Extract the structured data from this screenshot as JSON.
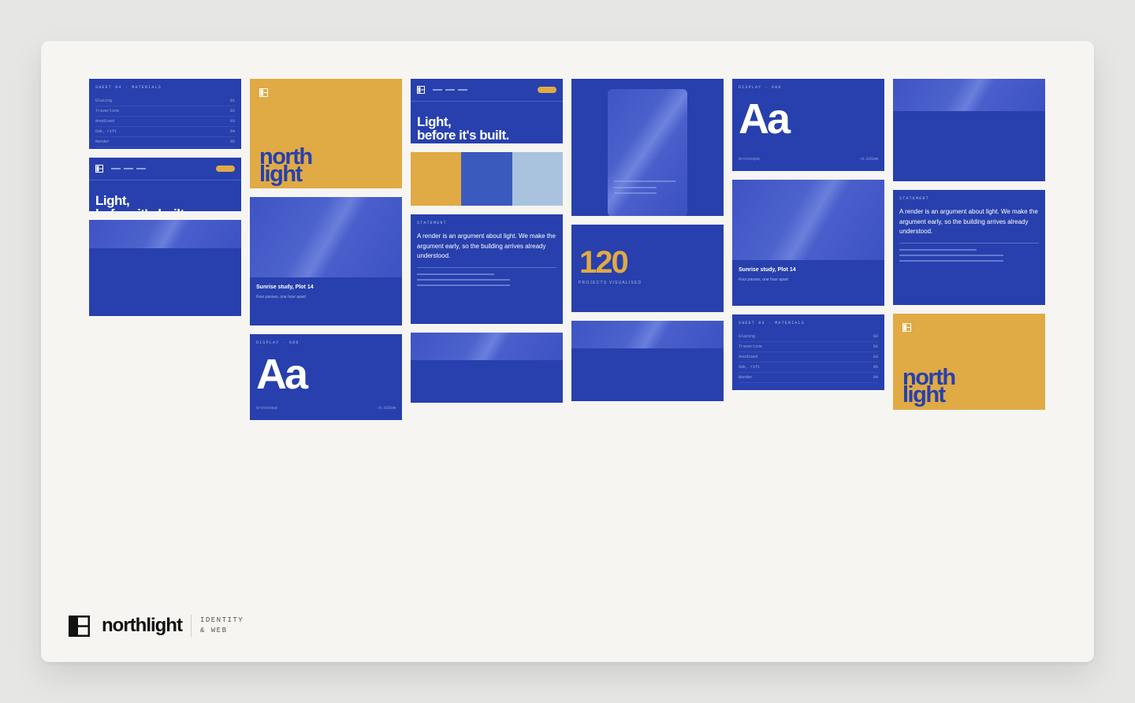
{
  "footer": {
    "wordmark": "northlight",
    "tagline_1": "IDENTITY",
    "tagline_2": "& WEB"
  },
  "materials": {
    "eyebrow": "SHEET 04 · MATERIALS",
    "rows": [
      {
        "name": "Glazing",
        "code": "01"
      },
      {
        "name": "Travertine",
        "code": "02"
      },
      {
        "name": "Anodised",
        "code": "03"
      },
      {
        "name": "Oak, rift",
        "code": "04"
      },
      {
        "name": "Render",
        "code": "05"
      }
    ]
  },
  "materials_alt": {
    "eyebrow": "SHEET 03 · MATERIALS",
    "rows": [
      {
        "name": "Glazing",
        "code": "02"
      },
      {
        "name": "Travertine",
        "code": "01"
      },
      {
        "name": "Anodised",
        "code": "03"
      },
      {
        "name": "Oak, rift",
        "code": "05"
      },
      {
        "name": "Render",
        "code": "04"
      }
    ]
  },
  "hero": {
    "line1": "Light,",
    "line2": "before it's built."
  },
  "brand_card": {
    "line1": "north",
    "line2": "light"
  },
  "photo": {
    "caption": "Sunrise study, Plot 14",
    "sub": "Four passes, one hour apart."
  },
  "statement": {
    "eyebrow": "STATEMENT",
    "text": "A render is an argument about light. We make the argument early, so the building arrives already understood."
  },
  "type": {
    "eyebrow": "DISPLAY · 600",
    "sample": "Aa",
    "family": "Grotesque",
    "tracking": "−0.035em"
  },
  "stat": {
    "value": "120",
    "label": "PROJECTS VISUALISED"
  },
  "colors": {
    "blue": "#2740ad",
    "yellow": "#e0aa45",
    "mid_blue": "#3a5bbd",
    "pale_blue": "#a9c3df"
  }
}
